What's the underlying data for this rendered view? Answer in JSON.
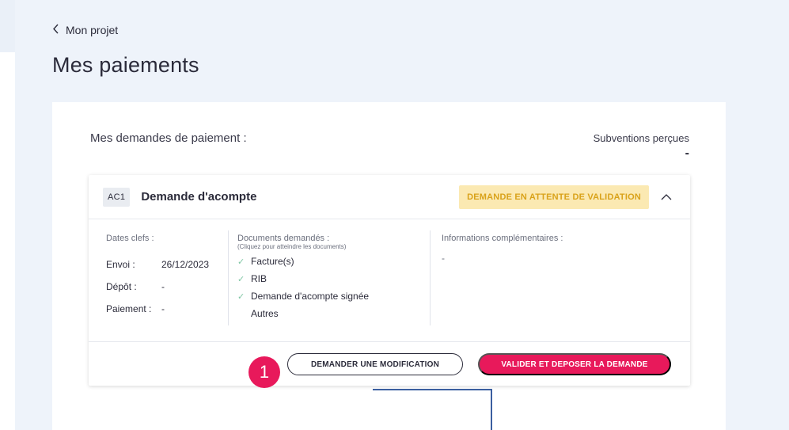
{
  "nav": {
    "back_label": "Mon projet"
  },
  "page": {
    "title": "Mes paiements"
  },
  "payments": {
    "heading": "Mes demandes de paiement :",
    "subventions_label": "Subventions perçues",
    "subventions_value": "-"
  },
  "request": {
    "ref": "AC1",
    "title": "Demande d'acompte",
    "status": "DEMANDE EN ATTENTE DE VALIDATION",
    "dates": {
      "label": "Dates clefs :",
      "rows": [
        {
          "key": "Envoi :",
          "value": "26/12/2023"
        },
        {
          "key": "Dépôt :",
          "value": "-"
        },
        {
          "key": "Paiement :",
          "value": "-"
        }
      ]
    },
    "documents": {
      "label": "Documents demandés :",
      "hint": "(Cliquez pour atteindre les documents)",
      "items": [
        {
          "label": "Facture(s)",
          "checked": true
        },
        {
          "label": "RIB",
          "checked": true
        },
        {
          "label": "Demande d'acompte signée",
          "checked": true
        },
        {
          "label": "Autres",
          "checked": false
        }
      ]
    },
    "info": {
      "label": "Informations complémentaires :",
      "value": "-"
    },
    "actions": {
      "modify_label": "DEMANDER UNE MODIFICATION",
      "submit_label": "VALIDER ET DEPOSER LA DEMANDE"
    }
  },
  "annotation": {
    "step_number": "1"
  },
  "colors": {
    "accent": "#e8195b",
    "status_bg": "#fbe9b2",
    "status_text": "#d9a21a",
    "check": "#7fc6a4",
    "connector": "#3b5fa0"
  },
  "icons": {
    "back": "chevron-left-icon",
    "collapse": "chevron-up-icon",
    "doc_check": "check-icon"
  }
}
